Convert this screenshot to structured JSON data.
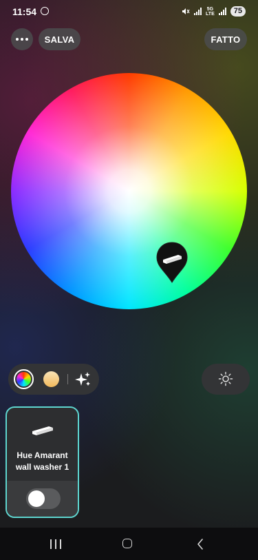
{
  "status_bar": {
    "time": "11:54",
    "network_label_1": "5G",
    "network_label_2": "LTE",
    "battery": "75"
  },
  "header": {
    "more_icon": "ellipsis-icon",
    "save_label": "SALVA",
    "done_label": "FATTO"
  },
  "color_wheel": {
    "marker_icon": "light-bar-icon"
  },
  "palette": {
    "color_wheel_swatch": "color-wheel-swatch",
    "white_temperature_swatch": "warm-white-swatch",
    "effects_icon": "sparkle-icon"
  },
  "brightness": {
    "icon": "sun-icon"
  },
  "lights": [
    {
      "name": "Hue Amarant wall washer 1",
      "icon": "light-bar-icon",
      "on": false
    }
  ],
  "nav_bar": {
    "recents_icon": "recents-icon",
    "home_icon": "home-icon",
    "back_icon": "back-icon"
  },
  "colors": {
    "accent_selection": "#5ed6d0",
    "background": "#1b1c1e",
    "control_surface": "#333436"
  }
}
